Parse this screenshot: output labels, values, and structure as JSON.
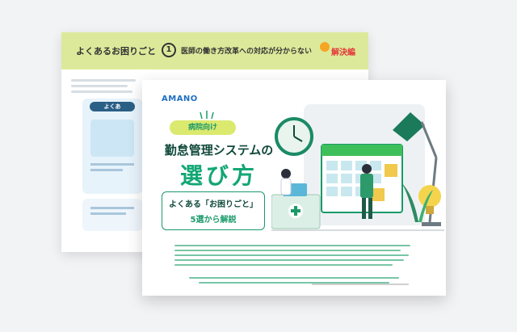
{
  "back_page": {
    "header_title": "よくあるお困りごと",
    "number": "1",
    "question": "医師の働き方改革への対応が分からない",
    "tag": "解決編",
    "panel_label": "よくあ"
  },
  "front_page": {
    "logo": "AMANO",
    "pill": "病院向け",
    "title_line1": "勤怠管理システムの",
    "title_line2": "選び方",
    "subtitle_line1": "よくある「お困りごと」",
    "subtitle_line2": "5選から解説"
  },
  "colors": {
    "accent_green": "#12a774",
    "lime": "#dbe96e",
    "brand_blue": "#1e6fc4"
  }
}
